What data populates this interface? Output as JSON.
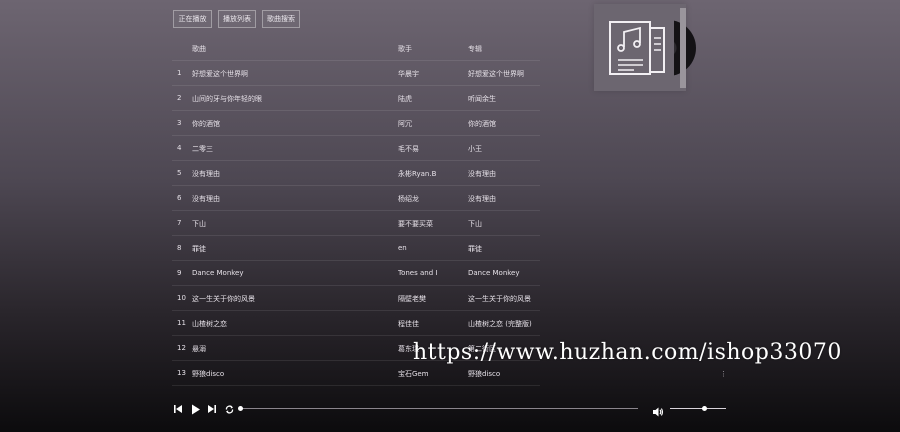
{
  "tabs": [
    "正在播放",
    "播放列表",
    "歌曲搜索"
  ],
  "list": {
    "headers": {
      "song": "歌曲",
      "artist": "歌手",
      "album": "专辑"
    },
    "rows": [
      {
        "idx": "1",
        "song": "好想爱这个世界啊",
        "artist": "华晨宇",
        "album": "好想爱这个世界啊"
      },
      {
        "idx": "2",
        "song": "山间的牙与你年轻的眼",
        "artist": "陆虎",
        "album": "听闻余生"
      },
      {
        "idx": "3",
        "song": "你的酒馆",
        "artist": "阿冗",
        "album": "你的酒馆"
      },
      {
        "idx": "4",
        "song": "二零三",
        "artist": "毛不易",
        "album": "小王"
      },
      {
        "idx": "5",
        "song": "没有理由",
        "artist": "永彬Ryan.B",
        "album": "没有理由"
      },
      {
        "idx": "6",
        "song": "没有理由",
        "artist": "杨绍龙",
        "album": "没有理由"
      },
      {
        "idx": "7",
        "song": "下山",
        "artist": "要不要买菜",
        "album": "下山"
      },
      {
        "idx": "8",
        "song": "罪徒",
        "artist": "en",
        "album": "罪徒"
      },
      {
        "idx": "9",
        "song": "Dance Monkey",
        "artist": "Tones and I",
        "album": "Dance Monkey"
      },
      {
        "idx": "10",
        "song": "这一生关于你的风景",
        "artist": "隔壁老樊",
        "album": "这一生关于你的风景"
      },
      {
        "idx": "11",
        "song": "山楂树之恋",
        "artist": "程佳佳",
        "album": "山楂树之恋 (完整版)"
      },
      {
        "idx": "12",
        "song": "悬溺",
        "artist": "葛东琪",
        "album": "第二街区"
      },
      {
        "idx": "13",
        "song": "野狼disco",
        "artist": "宝石Gem",
        "album": "野狼disco"
      }
    ]
  },
  "player": {
    "progress": 0,
    "volume": 0.6
  },
  "icons": {
    "prev": "skip-previous-icon",
    "play": "play-icon",
    "next": "skip-next-icon",
    "loop": "loop-icon",
    "volume": "volume-icon",
    "cover": "music-note-document-icon"
  },
  "scroll_dot": "⋮",
  "watermark": "https://www.huzhan.com/ishop33070"
}
